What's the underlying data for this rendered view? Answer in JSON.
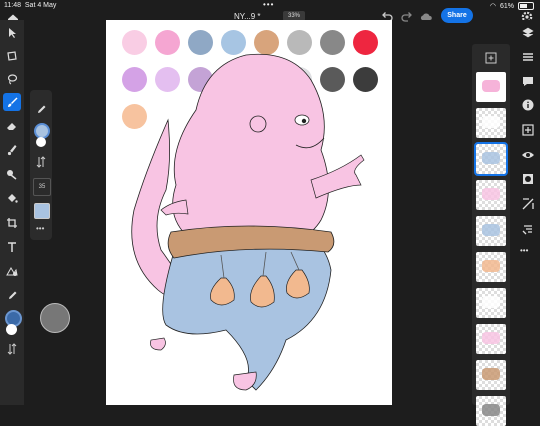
{
  "status": {
    "time": "11:48",
    "date": "Sat 4 May",
    "battery": "61%"
  },
  "document": {
    "title": "NY...9 *",
    "zoom": "33%"
  },
  "toolbar": {
    "share_label": "Share"
  },
  "subpanel": {
    "size_value": "35"
  },
  "colors": {
    "accent": "#1473e6",
    "current_fill": "#b8c8dc",
    "swatches": [
      "#f9cde4",
      "#f5a6d2",
      "#8fa8c5",
      "#a7c5e3",
      "#d8a47c",
      "#b9b9b9",
      "#888888",
      "#ee2640",
      "#d4a2e6",
      "#e4bff0",
      "#c4a3d6",
      "#b48ad0",
      "#bfdcf7",
      "#dedfe2",
      "#5a5a5a",
      "#3c3c3c",
      "#f7c39f"
    ],
    "skin": "#f8c4e3",
    "belt": "#c99a73",
    "pants": "#a9c3e1",
    "bag": "#f2b98f"
  },
  "icons": {
    "left_tools": [
      "select-icon",
      "transform-icon",
      "lasso-icon",
      "brush-icon",
      "eraser-icon",
      "smudge-icon",
      "fill-icon",
      "clone-icon",
      "crop-icon",
      "text-icon",
      "shape-icon",
      "eyedropper-icon",
      "color-icon",
      "swap-icon"
    ],
    "right_tools": [
      "layers-icon",
      "layer-properties-icon",
      "comments-icon",
      "info-icon",
      "add-layer-icon",
      "visibility-icon",
      "mask-icon",
      "adjust-icon",
      "link-icon",
      "more-icon"
    ]
  }
}
